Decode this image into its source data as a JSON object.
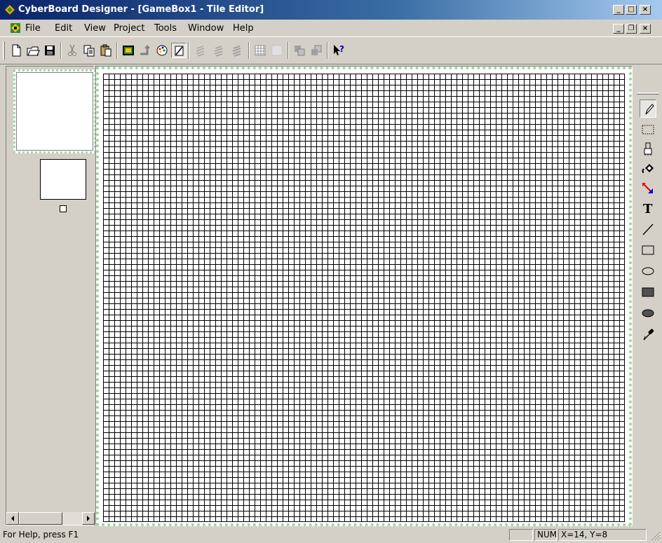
{
  "window": {
    "title": "CyberBoard Designer - [GameBox1 - Tile Editor]",
    "caption_buttons": {
      "minimize": "_",
      "maximize": "□",
      "close": "×"
    }
  },
  "menu": {
    "items": [
      "File",
      "Edit",
      "View",
      "Project",
      "Tools",
      "Window",
      "Help"
    ],
    "mdi_buttons": {
      "minimize": "_",
      "restore": "❐",
      "close": "×"
    }
  },
  "toolbar": {
    "buttons": [
      {
        "name": "new",
        "icon": "new-file-icon"
      },
      {
        "name": "open",
        "icon": "open-folder-icon"
      },
      {
        "name": "save",
        "icon": "save-disk-icon"
      },
      {
        "name": "cut",
        "icon": "scissors-icon"
      },
      {
        "name": "copy",
        "icon": "copy-icon"
      },
      {
        "name": "paste",
        "icon": "paste-icon"
      },
      {
        "name": "tile-editor",
        "icon": "tile-window-icon"
      },
      {
        "name": "rotate",
        "icon": "rotate-arrow-icon"
      },
      {
        "name": "color-palette",
        "icon": "palette-wheel-icon"
      },
      {
        "name": "no-tile",
        "icon": "no-tile-icon"
      },
      {
        "name": "line-width-1",
        "icon": "line-width-icon"
      },
      {
        "name": "line-width-2",
        "icon": "line-width-icon"
      },
      {
        "name": "line-width-3",
        "icon": "line-width-icon"
      },
      {
        "name": "show-grid",
        "icon": "grid-icon"
      },
      {
        "name": "show-fine-grid",
        "icon": "fine-grid-icon"
      },
      {
        "name": "move-back",
        "icon": "layer-back-icon"
      },
      {
        "name": "move-front",
        "icon": "layer-front-icon"
      },
      {
        "name": "context-help",
        "icon": "help-pointer-icon"
      }
    ]
  },
  "tools": [
    {
      "name": "pencil",
      "icon": "pencil-icon",
      "active": true
    },
    {
      "name": "select",
      "icon": "dotted-select-icon"
    },
    {
      "name": "brush",
      "icon": "brush-icon"
    },
    {
      "name": "fill",
      "icon": "paint-bucket-icon"
    },
    {
      "name": "color-change",
      "icon": "color-swap-icon"
    },
    {
      "name": "text",
      "icon": "text-icon",
      "label": "T"
    },
    {
      "name": "line",
      "icon": "line-icon"
    },
    {
      "name": "rectangle",
      "icon": "rectangle-outline-icon"
    },
    {
      "name": "ellipse",
      "icon": "ellipse-outline-icon"
    },
    {
      "name": "filled-rectangle",
      "icon": "rectangle-filled-icon"
    },
    {
      "name": "filled-ellipse",
      "icon": "ellipse-filled-icon"
    },
    {
      "name": "color-picker",
      "icon": "eyedropper-icon"
    }
  ],
  "status": {
    "help": "For Help, press F1",
    "pane_empty": "",
    "num": "NUM",
    "coords": "X=14, Y=8"
  },
  "colors": {
    "title_start": "#0a246a",
    "title_end": "#a6caf0",
    "canvas_border": "#9fd59f",
    "face": "#d4d0c8"
  }
}
